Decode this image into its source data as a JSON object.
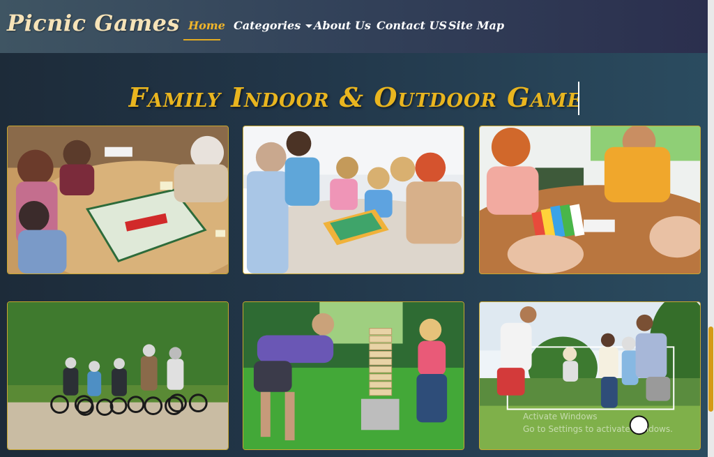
{
  "navbar": {
    "brand": "Picnic Games",
    "items": [
      {
        "label": "Home",
        "active": true
      },
      {
        "label": "Categories",
        "dropdown": true
      },
      {
        "label": "About Us"
      },
      {
        "label": "Contact US"
      },
      {
        "label": "Site Map"
      }
    ]
  },
  "main": {
    "title": "Family Indoor & Outdoor Games",
    "games": [
      {
        "name": "monopoly-board-game"
      },
      {
        "name": "family-floor-board-game"
      },
      {
        "name": "card-game-table"
      },
      {
        "name": "family-bike-ride"
      },
      {
        "name": "giant-jenga-lawn-game"
      },
      {
        "name": "family-backyard-soccer"
      }
    ]
  },
  "windows_watermark": {
    "line1": "Activate Windows",
    "line2": "Go to Settings to activate Windows."
  },
  "colors": {
    "accent": "#e9b51f",
    "active_nav": "#f0b52a",
    "card_border": "#c9a72e"
  }
}
